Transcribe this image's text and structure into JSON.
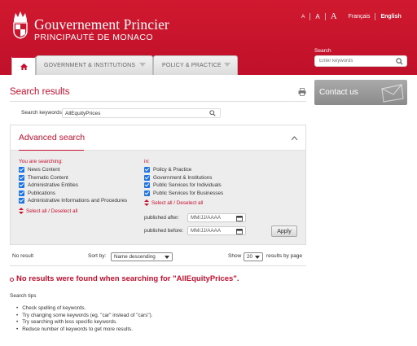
{
  "header": {
    "title": "Gouvernement Princier",
    "subtitle": "PRINCIPAUTÉ DE MONACO",
    "font_sizes": [
      "A",
      "A",
      "A"
    ],
    "lang_fr": "Français",
    "lang_en": "English",
    "search_label": "Search",
    "search_placeholder": "Enter keywords"
  },
  "nav": {
    "tabs": [
      {
        "label": "GOVERNMENT & INSTITUTIONS"
      },
      {
        "label": "POLICY & PRACTICE"
      }
    ]
  },
  "page": {
    "title": "Search results",
    "keywords_label": "Search keywords",
    "keywords_value": "AllEquityPrices"
  },
  "contact": {
    "label": "Contact us"
  },
  "advanced": {
    "title": "Advanced search",
    "you_are_searching_label": "You are searching:",
    "in_label": "in:",
    "content_types": [
      "News Content",
      "Thematic Content",
      "Administrative Entities",
      "Publications",
      "Administrative Informations and Procedures"
    ],
    "sections": [
      "Policy & Practice",
      "Government & Institutions",
      "Public Services for Individuals",
      "Public Services for Businesses"
    ],
    "select_all": "Select all / Deselect all",
    "published_after_label": "published after:",
    "published_before_label": "published before:",
    "date_placeholder": "MM/JJ/AAAA",
    "apply_label": "Apply"
  },
  "results": {
    "count_text": "No result",
    "sort_label": "Sort by:",
    "sort_value": "Name descending",
    "show_label": "Show",
    "show_value": "20",
    "per_page_label": "results by page",
    "no_results_message": "No results were found when searching for \"AllEquityPrices\".",
    "tips_heading": "Search tips",
    "tips": [
      "Check spelling of keywords.",
      "Try changing some keywords (eg. \"car\" instead of \"cars\").",
      "Try searching with less specific keywords.",
      "Reduce number of keywords to get more results."
    ]
  },
  "colors": {
    "brand_red": "#c8102e",
    "checkbox_blue": "#1a73e8"
  }
}
